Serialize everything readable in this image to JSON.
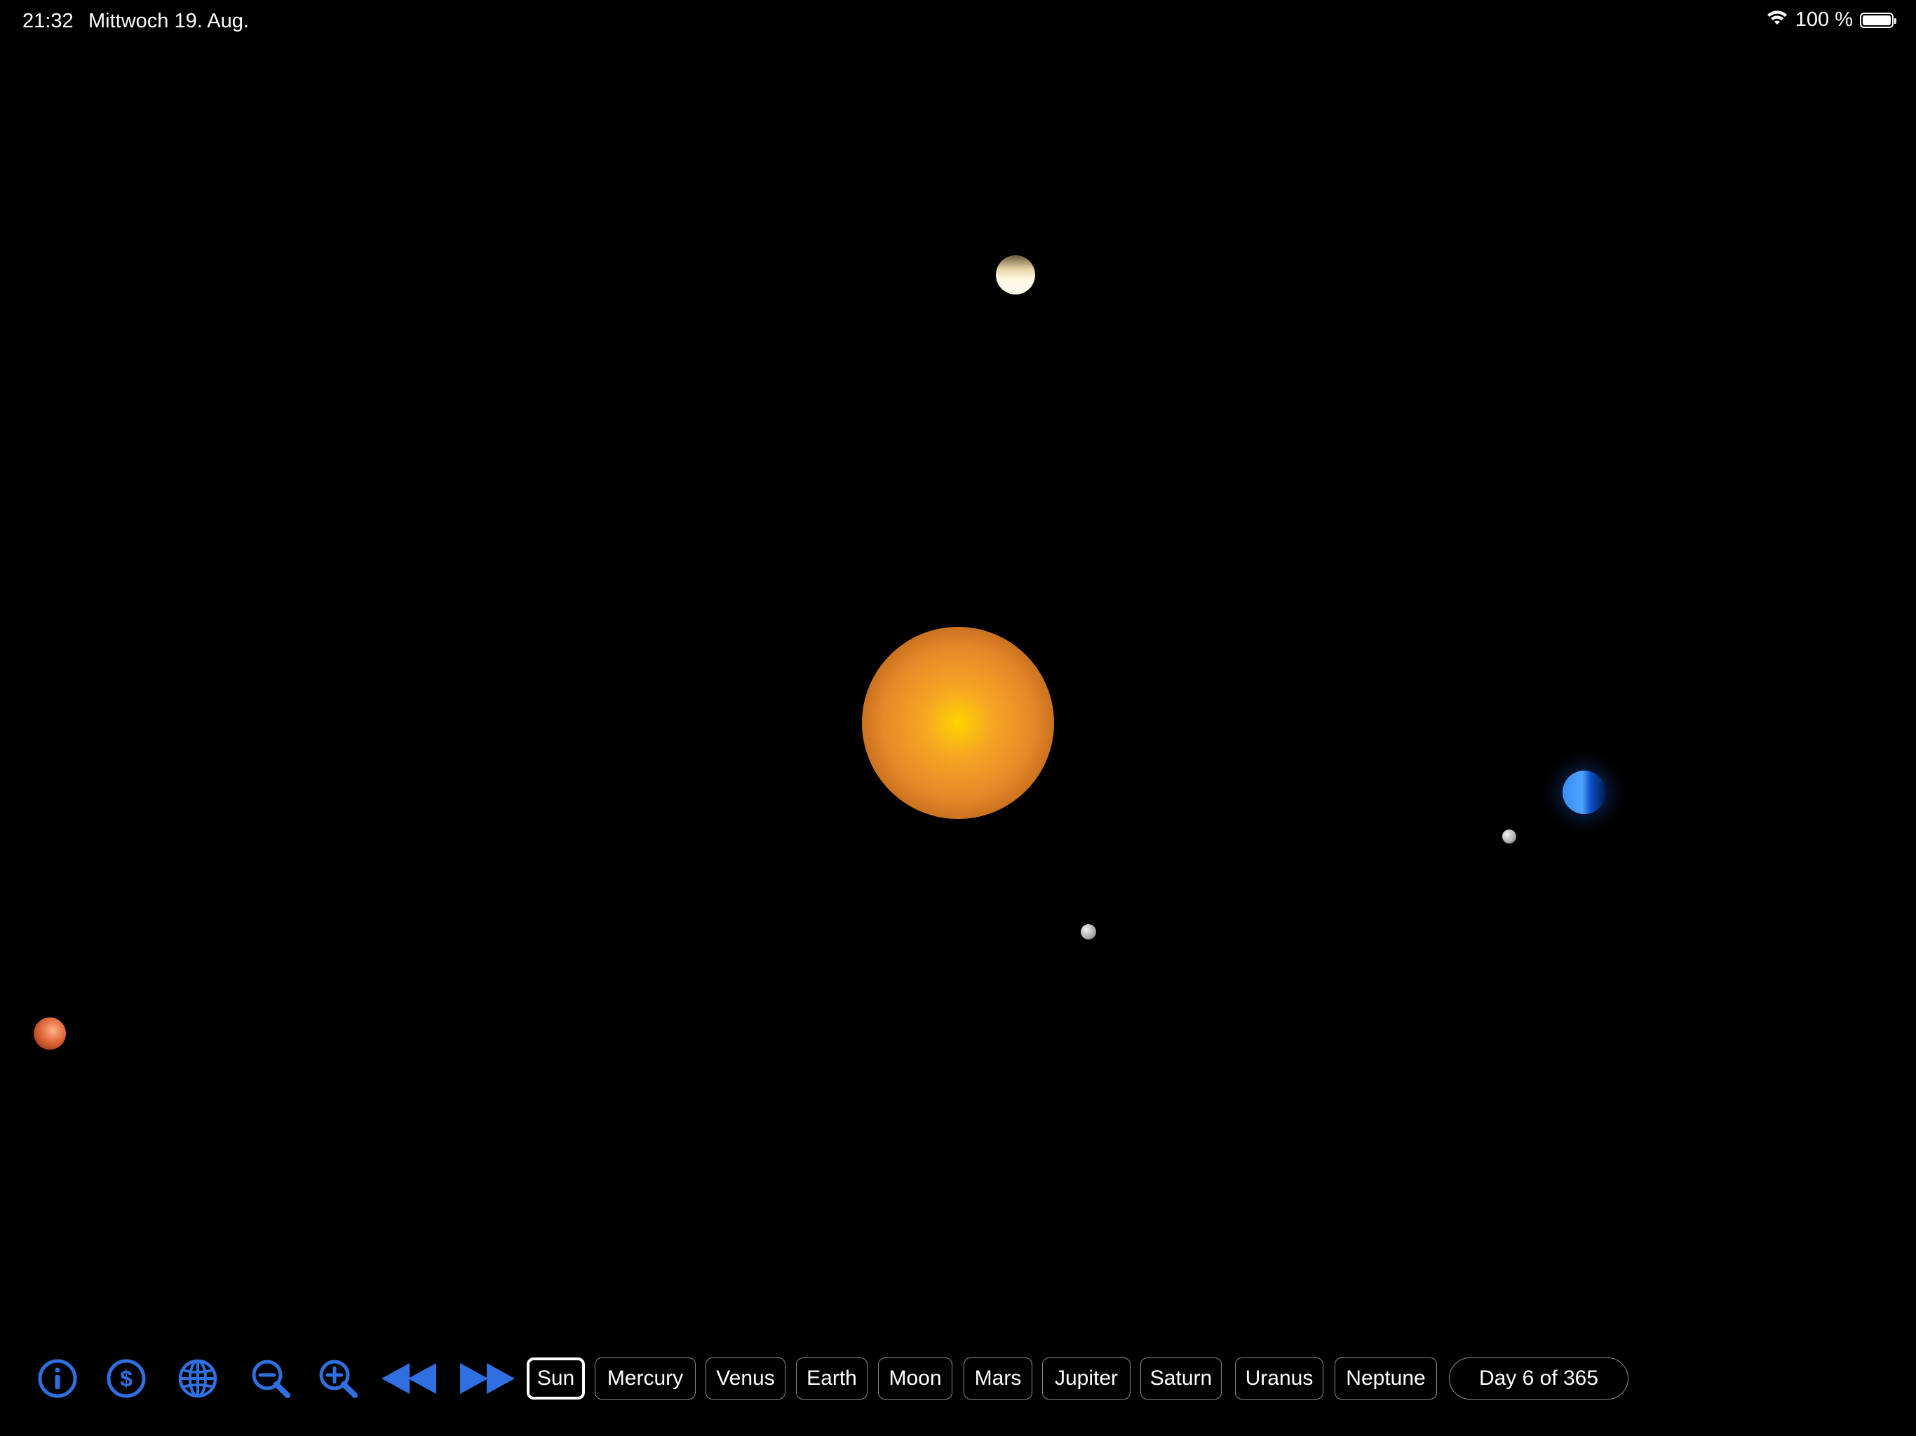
{
  "status_bar": {
    "time": "21:32",
    "date": "Mittwoch 19. Aug.",
    "battery_text": "100 %",
    "icons": [
      "wifi-icon",
      "battery-icon"
    ]
  },
  "scene": {
    "bodies": [
      "sun",
      "venus",
      "earth",
      "moon",
      "mercury",
      "mars"
    ]
  },
  "toolbar": {
    "accent_color": "#2f6fe0",
    "icons": [
      "info-icon",
      "dollar-icon",
      "globe-icon",
      "zoom-out-icon",
      "zoom-in-icon",
      "rewind-icon",
      "fast-forward-icon"
    ],
    "planets": [
      {
        "label": "Sun",
        "active": true
      },
      {
        "label": "Mercury",
        "active": false
      },
      {
        "label": "Venus",
        "active": false
      },
      {
        "label": "Earth",
        "active": false
      },
      {
        "label": "Moon",
        "active": false
      },
      {
        "label": "Mars",
        "active": false
      },
      {
        "label": "Jupiter",
        "active": false
      },
      {
        "label": "Saturn",
        "active": false
      },
      {
        "label": "Uranus",
        "active": false
      },
      {
        "label": "Neptune",
        "active": false
      }
    ],
    "day_label": "Day 6 of 365"
  }
}
